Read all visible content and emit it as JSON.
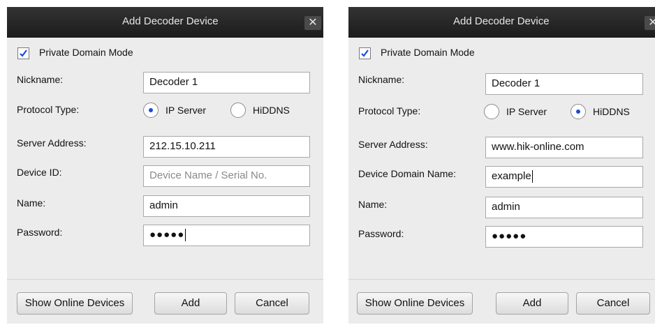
{
  "dialogs": [
    {
      "title": "Add Decoder Device",
      "private_domain_mode": {
        "label": "Private Domain Mode",
        "checked": true
      },
      "nickname": {
        "label": "Nickname:",
        "value": "Decoder 1"
      },
      "protocol_type": {
        "label": "Protocol Type:",
        "options": [
          "IP Server",
          "HiDDNS"
        ],
        "selected": "IP Server"
      },
      "server_address": {
        "label": "Server Address:",
        "value": "212.15.10.211"
      },
      "device_id": {
        "label": "Device ID:",
        "value": "",
        "placeholder": "Device Name / Serial No."
      },
      "name": {
        "label": "Name:",
        "value": "admin"
      },
      "password": {
        "label": "Password:",
        "value": "●●●●●"
      },
      "buttons": {
        "show_online": "Show Online Devices",
        "add": "Add",
        "cancel": "Cancel"
      }
    },
    {
      "title": "Add Decoder Device",
      "private_domain_mode": {
        "label": "Private Domain Mode",
        "checked": true
      },
      "nickname": {
        "label": "Nickname:",
        "value": "Decoder 1"
      },
      "protocol_type": {
        "label": "Protocol Type:",
        "options": [
          "IP Server",
          "HiDDNS"
        ],
        "selected": "HiDDNS"
      },
      "server_address": {
        "label": "Server Address:",
        "value": "www.hik-online.com"
      },
      "device_domain_name": {
        "label": "Device Domain Name:",
        "value": "example"
      },
      "name": {
        "label": "Name:",
        "value": "admin"
      },
      "password": {
        "label": "Password:",
        "value": "●●●●●"
      },
      "buttons": {
        "show_online": "Show Online Devices",
        "add": "Add",
        "cancel": "Cancel"
      }
    }
  ],
  "colors": {
    "titlebar": "#1f1f1f",
    "dialog_bg": "#ececec",
    "radio_dot": "#1a4bd6",
    "check": "#1a4bd6"
  },
  "icons": {
    "close": "close-icon",
    "check": "checkmark-icon"
  }
}
